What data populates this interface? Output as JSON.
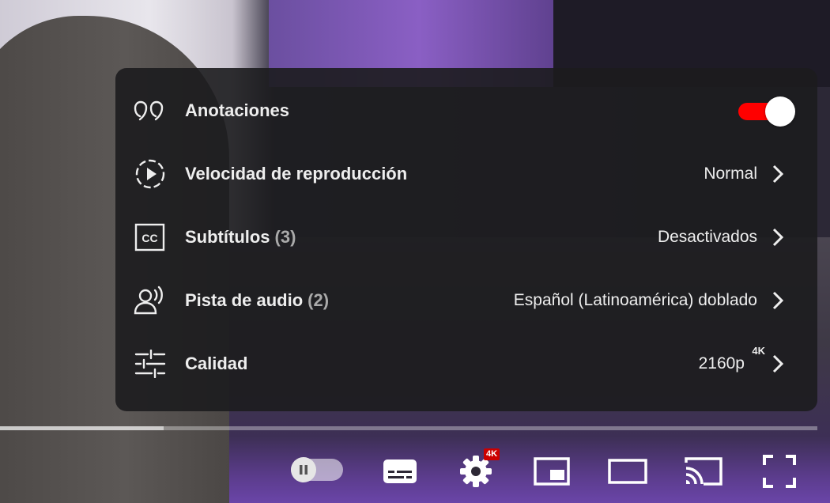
{
  "settings_menu": {
    "items": [
      {
        "label": "Anotaciones",
        "icon": "annotations-icon",
        "toggle_on": true
      },
      {
        "label": "Velocidad de reproducción",
        "icon": "playback-speed-icon",
        "value": "Normal"
      },
      {
        "label": "Subtítulos",
        "count": "(3)",
        "icon": "subtitles-icon",
        "value": "Desactivados"
      },
      {
        "label": "Pista de audio",
        "count": "(2)",
        "icon": "audio-track-icon",
        "value": "Español (Latinoamérica) doblado"
      },
      {
        "label": "Calidad",
        "icon": "quality-icon",
        "value": "2160p",
        "value_badge": "4K"
      }
    ]
  },
  "player": {
    "progress_fraction": 0.2,
    "autoplay_on": false,
    "settings_badge": "4K",
    "accent_color": "#ff0000",
    "controls": [
      "autoplay-toggle",
      "subtitles-button",
      "settings-button",
      "miniplayer-button",
      "theater-mode-button",
      "cast-button",
      "fullscreen-button"
    ]
  }
}
